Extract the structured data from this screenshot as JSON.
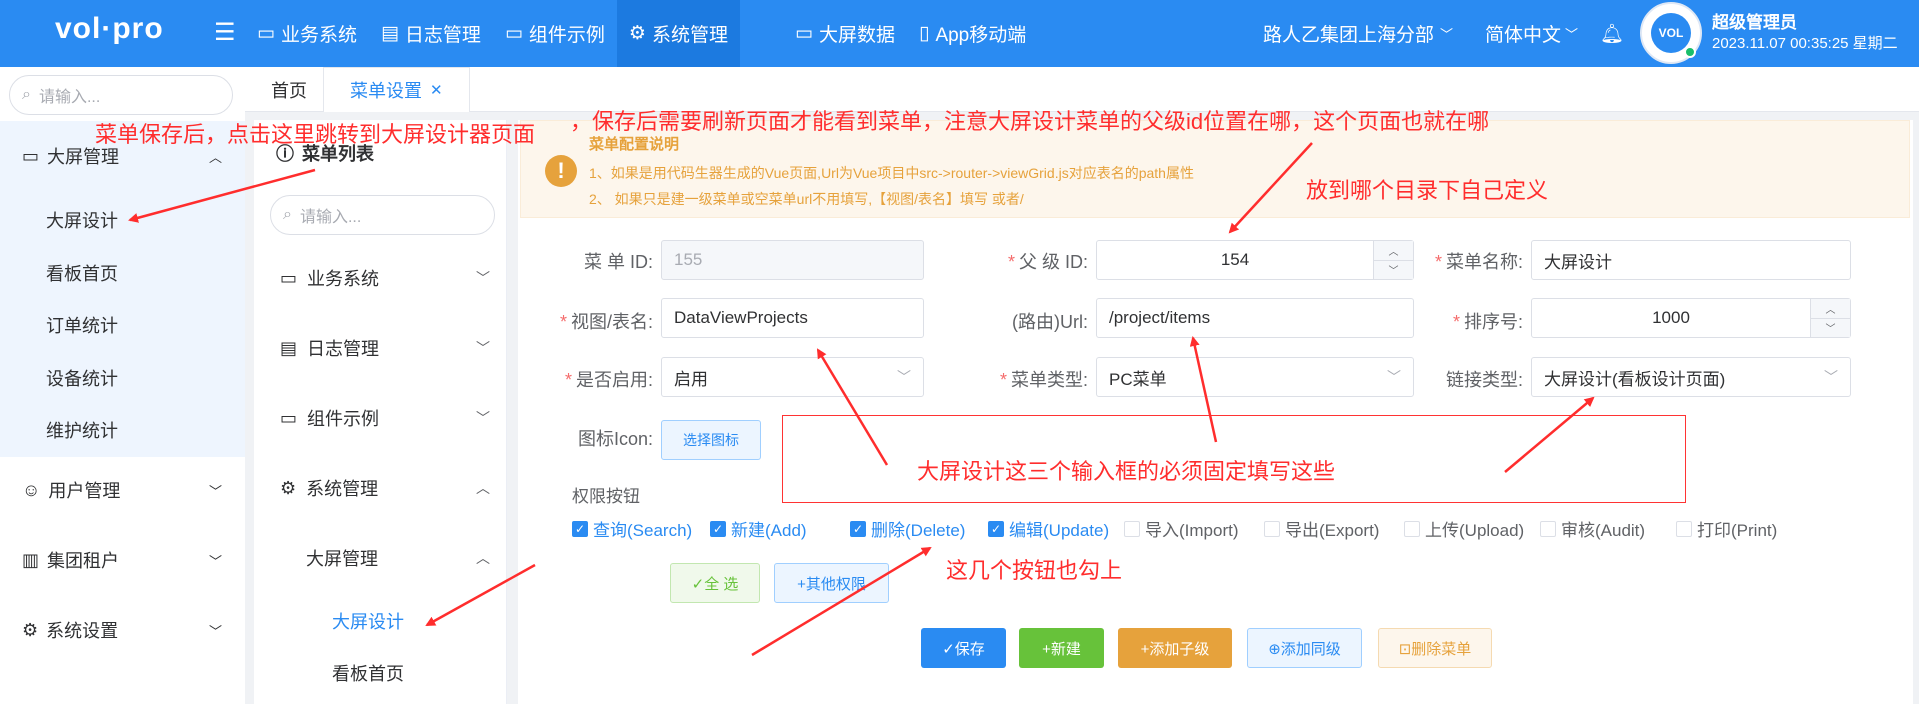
{
  "app": {
    "logo": "vol·pro",
    "top_nav": [
      {
        "label": "业务系统",
        "icon": "monitor-icon"
      },
      {
        "label": "日志管理",
        "icon": "calendar-icon"
      },
      {
        "label": "组件示例",
        "icon": "monitor-icon"
      },
      {
        "label": "系统管理",
        "icon": "gear-icon"
      },
      {
        "label": "大屏数据",
        "icon": "screen-icon"
      },
      {
        "label": "App移动端",
        "icon": "phone-icon"
      }
    ],
    "org": "路人乙集团上海分部",
    "lang": "简体中文",
    "avatar_text": "VOL",
    "user_name": "超级管理员",
    "user_time": "2023.11.07 00:35:25 星期二",
    "accent": "#2a8bf2"
  },
  "sidebar": {
    "search_placeholder": "请输入...",
    "groups": [
      {
        "label": "大屏管理",
        "icon": "monitor-icon"
      },
      {
        "label": "用户管理",
        "icon": "user-icon"
      },
      {
        "label": "集团租户",
        "icon": "building-icon"
      },
      {
        "label": "系统设置",
        "icon": "gear-icon"
      }
    ],
    "sub_items": [
      "大屏设计",
      "看板首页",
      "订单统计",
      "设备统计",
      "维护统计"
    ]
  },
  "tabs": [
    {
      "label": "首页"
    },
    {
      "label": "菜单设置",
      "close": "✕"
    }
  ],
  "menu_panel": {
    "title": "菜单列表",
    "search_placeholder": "请输入...",
    "items": [
      "业务系统",
      "日志管理",
      "组件示例",
      "系统管理",
      "大屏管理",
      "大屏设计",
      "看板首页"
    ]
  },
  "notice": {
    "title": "菜单配置说明",
    "line1": "1、如果是用代码生器生成的Vue页面,Url为Vue项目中src->router->viewGrid.js对应表名的path属性",
    "line2": "2、 如果只是建一级菜单或空菜单url不用填写,【视图/表名】填写 或者/"
  },
  "form": {
    "menu_id": {
      "label": "菜 单 ID:",
      "value": "155"
    },
    "parent_id": {
      "label": "父 级 ID:",
      "value": "154"
    },
    "menu_name": {
      "label": "菜单名称:",
      "value": "大屏设计"
    },
    "view_table": {
      "label": "视图/表名:",
      "value": "DataViewProjects"
    },
    "url": {
      "label": "(路由)Url:",
      "value": "/project/items"
    },
    "order": {
      "label": "排序号:",
      "value": "1000"
    },
    "enabled": {
      "label": "是否启用:",
      "value": "启用"
    },
    "menu_type": {
      "label": "菜单类型:",
      "value": "PC菜单"
    },
    "link_type": {
      "label": "链接类型:",
      "value": "大屏设计(看板设计页面)"
    },
    "icon": {
      "label": "图标Icon:",
      "button": "选择图标"
    },
    "perm_label": "权限按钮",
    "perms": [
      {
        "label": "查询(Search)",
        "checked": true
      },
      {
        "label": "新建(Add)",
        "checked": true
      },
      {
        "label": "删除(Delete)",
        "checked": true
      },
      {
        "label": "编辑(Update)",
        "checked": true
      },
      {
        "label": "导入(Import)",
        "checked": false
      },
      {
        "label": "导出(Export)",
        "checked": false
      },
      {
        "label": "上传(Upload)",
        "checked": false
      },
      {
        "label": "审核(Audit)",
        "checked": false
      },
      {
        "label": "打印(Print)",
        "checked": false
      }
    ],
    "select_all": "✓全 选",
    "other_perms": "+其他权限"
  },
  "actions": {
    "save": "✓保存",
    "add": "+新建",
    "add_child": "+添加子级",
    "add_sibling": "⊕添加同级",
    "delete": "⊡删除菜单"
  },
  "annotations": {
    "a1": "菜单保存后，点击这里跳转到大屏设计器页面",
    "a2": "，保存后需要刷新页面才能看到菜单，注意大屏设计菜单的父级id位置在哪，这个页面也就在哪",
    "a3": "放到哪个目录下自己定义",
    "a4": "大屏设计这三个输入框的必须固定填写这些",
    "a5": "这几个按钮也勾上"
  },
  "colors": {
    "primary": "#2a8bf2",
    "success": "#67c23a",
    "warning": "#e6a23c",
    "annotation": "#ff2d2d"
  }
}
